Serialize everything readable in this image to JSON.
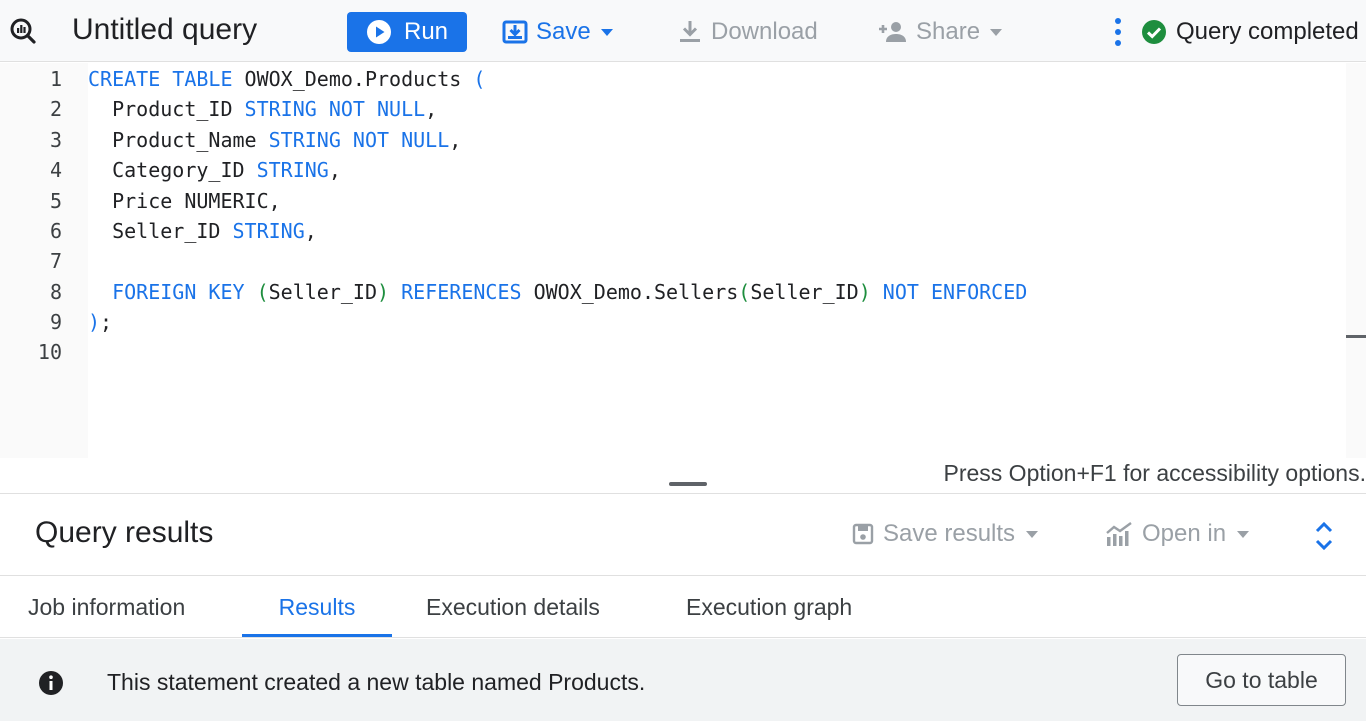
{
  "toolbar": {
    "title": "Untitled query",
    "run_label": "Run",
    "save_label": "Save",
    "download_label": "Download",
    "share_label": "Share",
    "status_text": "Query completed"
  },
  "editor": {
    "line_numbers": [
      "1",
      "2",
      "3",
      "4",
      "5",
      "6",
      "7",
      "8",
      "9",
      "10"
    ],
    "lines": [
      [
        {
          "t": "CREATE TABLE",
          "c": "kw"
        },
        {
          "t": " OWOX_Demo.Products ",
          "c": ""
        },
        {
          "t": "(",
          "c": "pb"
        }
      ],
      [
        {
          "t": "  Product_ID ",
          "c": ""
        },
        {
          "t": "STRING NOT NULL",
          "c": "kw"
        },
        {
          "t": ",",
          "c": ""
        }
      ],
      [
        {
          "t": "  Product_Name ",
          "c": ""
        },
        {
          "t": "STRING NOT NULL",
          "c": "kw"
        },
        {
          "t": ",",
          "c": ""
        }
      ],
      [
        {
          "t": "  Category_ID ",
          "c": ""
        },
        {
          "t": "STRING",
          "c": "kw"
        },
        {
          "t": ",",
          "c": ""
        }
      ],
      [
        {
          "t": "  Price NUMERIC,",
          "c": ""
        }
      ],
      [
        {
          "t": "  Seller_ID ",
          "c": ""
        },
        {
          "t": "STRING",
          "c": "kw"
        },
        {
          "t": ",",
          "c": ""
        }
      ],
      [],
      [
        {
          "t": "  ",
          "c": ""
        },
        {
          "t": "FOREIGN KEY",
          "c": "kw"
        },
        {
          "t": " ",
          "c": ""
        },
        {
          "t": "(",
          "c": "par"
        },
        {
          "t": "Seller_ID",
          "c": ""
        },
        {
          "t": ")",
          "c": "par"
        },
        {
          "t": " ",
          "c": ""
        },
        {
          "t": "REFERENCES",
          "c": "kw"
        },
        {
          "t": " OWOX_Demo.Sellers",
          "c": ""
        },
        {
          "t": "(",
          "c": "par"
        },
        {
          "t": "Seller_ID",
          "c": ""
        },
        {
          "t": ")",
          "c": "par"
        },
        {
          "t": " ",
          "c": ""
        },
        {
          "t": "NOT ENFORCED",
          "c": "kw"
        }
      ],
      [
        {
          "t": ")",
          "c": "pb"
        },
        {
          "t": ";",
          "c": ""
        }
      ],
      []
    ],
    "accessibility_hint": "Press Option+F1 for accessibility options."
  },
  "results": {
    "title": "Query results",
    "save_results_label": "Save results",
    "open_in_label": "Open in",
    "tabs": [
      "Job information",
      "Results",
      "Execution details",
      "Execution graph"
    ],
    "active_tab": "Results",
    "info_message": "This statement created a new table named Products.",
    "go_to_table_label": "Go to table"
  },
  "colors": {
    "accent": "#1a73e8",
    "success": "#1e8e3e",
    "disabled": "#9aa0a6"
  },
  "icons": [
    "query-icon",
    "play-icon",
    "save-icon",
    "download-icon",
    "share-person-icon",
    "more-vert-icon",
    "check-circle-icon",
    "save-results-icon",
    "chart-icon",
    "expand-icon",
    "info-icon"
  ]
}
